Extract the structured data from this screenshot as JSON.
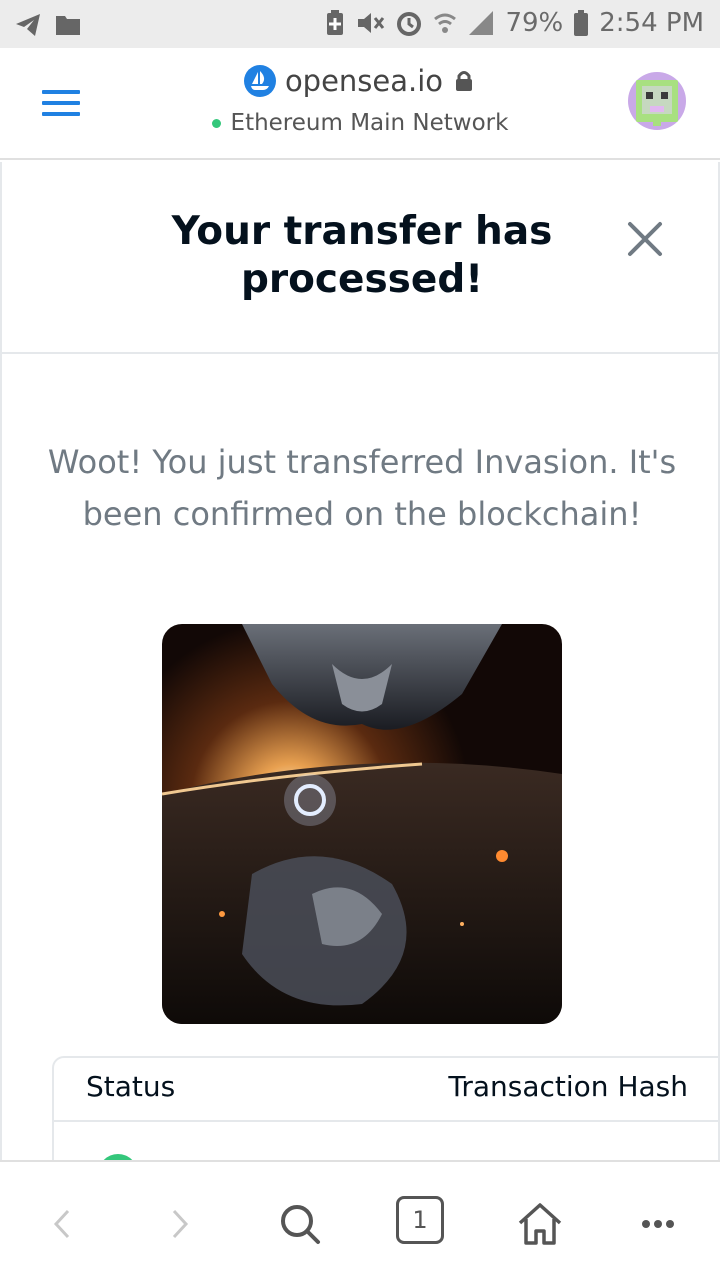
{
  "status_bar": {
    "battery": "79%",
    "time": "2:54 PM"
  },
  "browser": {
    "url": "opensea.io",
    "network": "Ethereum Main Network",
    "tab_count": "1"
  },
  "modal": {
    "title": "Your transfer has processed!",
    "message": "Woot! You just transferred Invasion. It's been confirmed on the blockchain!",
    "table": {
      "columns": [
        "Status",
        "Transaction Hash"
      ]
    }
  },
  "colors": {
    "accent": "#2081e2",
    "success": "#34c77b",
    "text_primary": "#04111d",
    "text_secondary": "#707a83"
  }
}
